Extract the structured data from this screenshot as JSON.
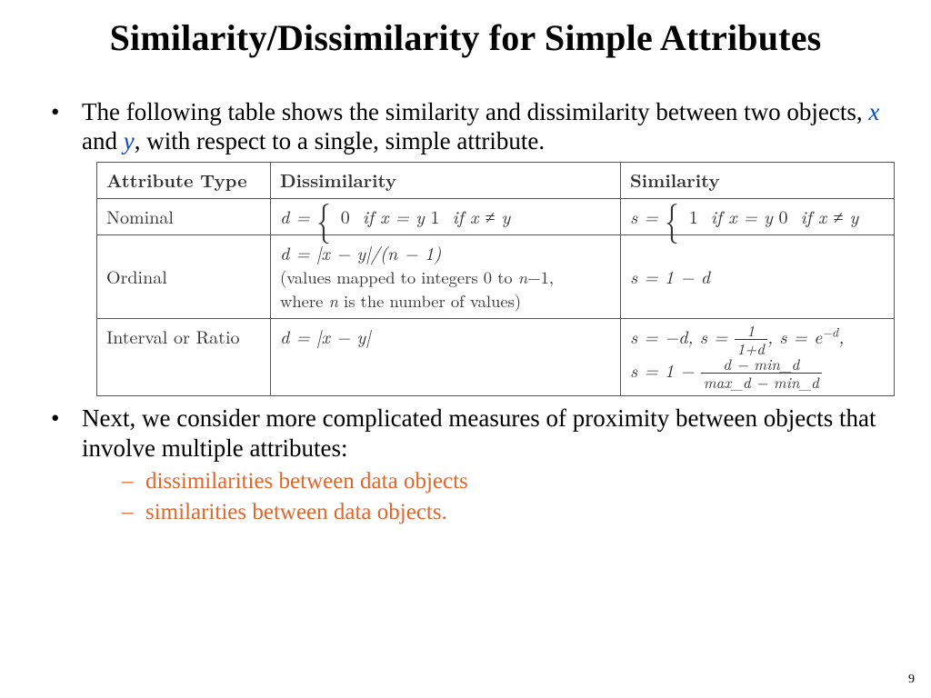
{
  "title": "Similarity/Dissimilarity for Simple Attributes",
  "bullets": {
    "b1_pre": "The following table shows the similarity and dissimilarity between two objects, ",
    "b1_x": "x",
    "b1_mid": " and ",
    "b1_y": "y",
    "b1_post": ", with respect to a single, simple attribute.",
    "b2": "Next, we consider more complicated measures of proximity between objects that involve multiple attributes:",
    "sub1": "dissimilarities between data objects",
    "sub2": "similarities between data objects."
  },
  "table": {
    "headers": {
      "attr": "Attribute Type",
      "diss": "Dissimilarity",
      "sim": "Similarity"
    },
    "rows": {
      "nominal": {
        "attr": "Nominal",
        "d_eq": "d =",
        "d_case0": "0",
        "d_case0_cond": "if x = y",
        "d_case1": "1",
        "d_case1_cond": "if x ≠ y",
        "s_eq": "s =",
        "s_case1": "1",
        "s_case1_cond": "if x = y",
        "s_case0": "0",
        "s_case0_cond": "if x ≠ y"
      },
      "ordinal": {
        "attr": "Ordinal",
        "diss_line1": "d = |x − y|/(n − 1)",
        "diss_line2a": "(values mapped to integers 0 to ",
        "diss_line2b": "n",
        "diss_line2c": "−1,",
        "diss_line3a": "where ",
        "diss_line3b": "n",
        "diss_line3c": " is the number of values)",
        "sim": "s = 1 − d"
      },
      "interval": {
        "attr": "Interval or Ratio",
        "diss": "d = |x − y|",
        "sim_seg1": "s = −d, s = ",
        "frac1_num": "1",
        "frac1_den": "1+d",
        "sim_seg2": ", s = e",
        "sim_exp": "−d",
        "sim_seg3": ",",
        "sim_line2_pre": "s = 1 − ",
        "frac2_num": "d − min_d",
        "frac2_den": "max_d − min_d"
      }
    }
  },
  "page_number": "9"
}
